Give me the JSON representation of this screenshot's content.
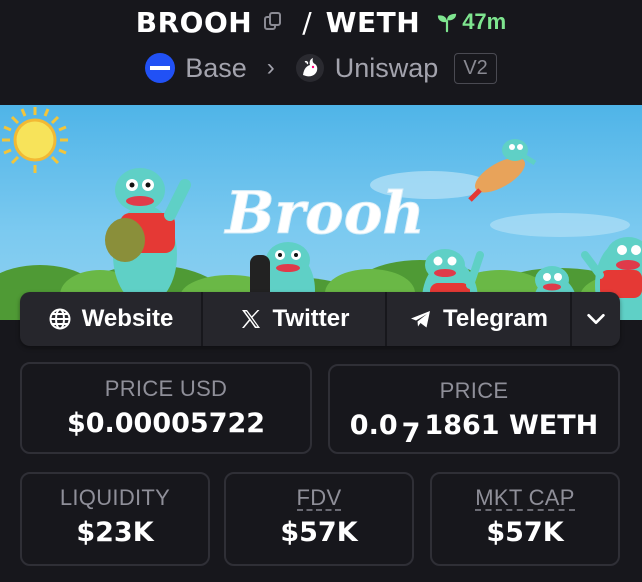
{
  "header": {
    "base_symbol": "BROOH",
    "separator": "/",
    "quote_symbol": "WETH",
    "age": "47m",
    "chain": "Base",
    "dex": "Uniswap",
    "dex_version": "V2"
  },
  "banner": {
    "title": "Brooh"
  },
  "links": {
    "website": "Website",
    "twitter": "Twitter",
    "telegram": "Telegram"
  },
  "stats": {
    "price_usd": {
      "label": "PRICE USD",
      "value": "$0.00005722"
    },
    "price": {
      "label": "PRICE",
      "prefix": "0.0",
      "zeros": "7",
      "suffix": "1861 WETH"
    },
    "liquidity": {
      "label": "LIQUIDITY",
      "value": "$23K"
    },
    "fdv": {
      "label": "FDV",
      "value": "$57K"
    },
    "mkt_cap": {
      "label": "MKT CAP",
      "value": "$57K"
    }
  },
  "colors": {
    "background": "#17171c",
    "card_border": "#2f2f36",
    "age_green": "#7ee58f",
    "base_blue": "#2151f5",
    "muted_text": "#8f8f99"
  },
  "icons": [
    "copy-icon",
    "sprout-icon",
    "base-chain-icon",
    "chevron-right-icon",
    "uniswap-icon",
    "globe-icon",
    "x-icon",
    "telegram-icon",
    "chevron-down-icon"
  ]
}
